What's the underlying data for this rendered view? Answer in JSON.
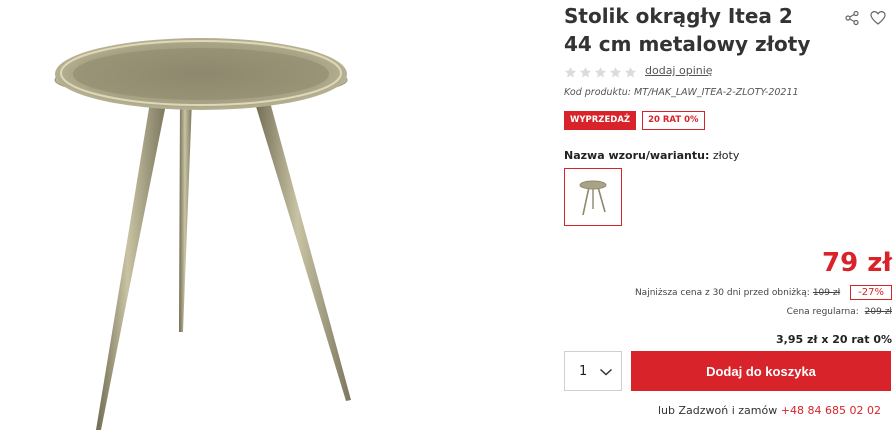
{
  "product": {
    "title": "Stolik okrągły Itea 2 44 cm metalowy złoty",
    "review_link": "dodaj opinię",
    "rating": 0,
    "stars_total": 5,
    "code": "Kod produktu: MT/HAK_LAW_ITEA-2-ZLOTY-20211"
  },
  "badges": {
    "sale": "WYPRZEDAŻ",
    "installments": "20 RAT 0%"
  },
  "variant": {
    "label": "Nazwa wzoru/wariantu:",
    "value": "złoty"
  },
  "pricing": {
    "price": "79 zł",
    "lowest_label": "Najniższa cena z 30 dni przed obniżką:",
    "lowest_old": "109 zł",
    "discount": "-27%",
    "regular_label": "Cena regularna:",
    "regular_old": "209 zł",
    "installment": "3,95 zł x 20 rat 0%"
  },
  "cart": {
    "quantity": "1",
    "add_label": "Dodaj do koszyka"
  },
  "contact": {
    "prefix": "lub Zadzwoń i zamów",
    "phone": "+48 84 685 02 02"
  },
  "icons": {
    "share": "share-icon",
    "wishlist": "heart-icon"
  },
  "colors": {
    "accent": "#d8232a",
    "star_empty": "#dcdcdc"
  }
}
